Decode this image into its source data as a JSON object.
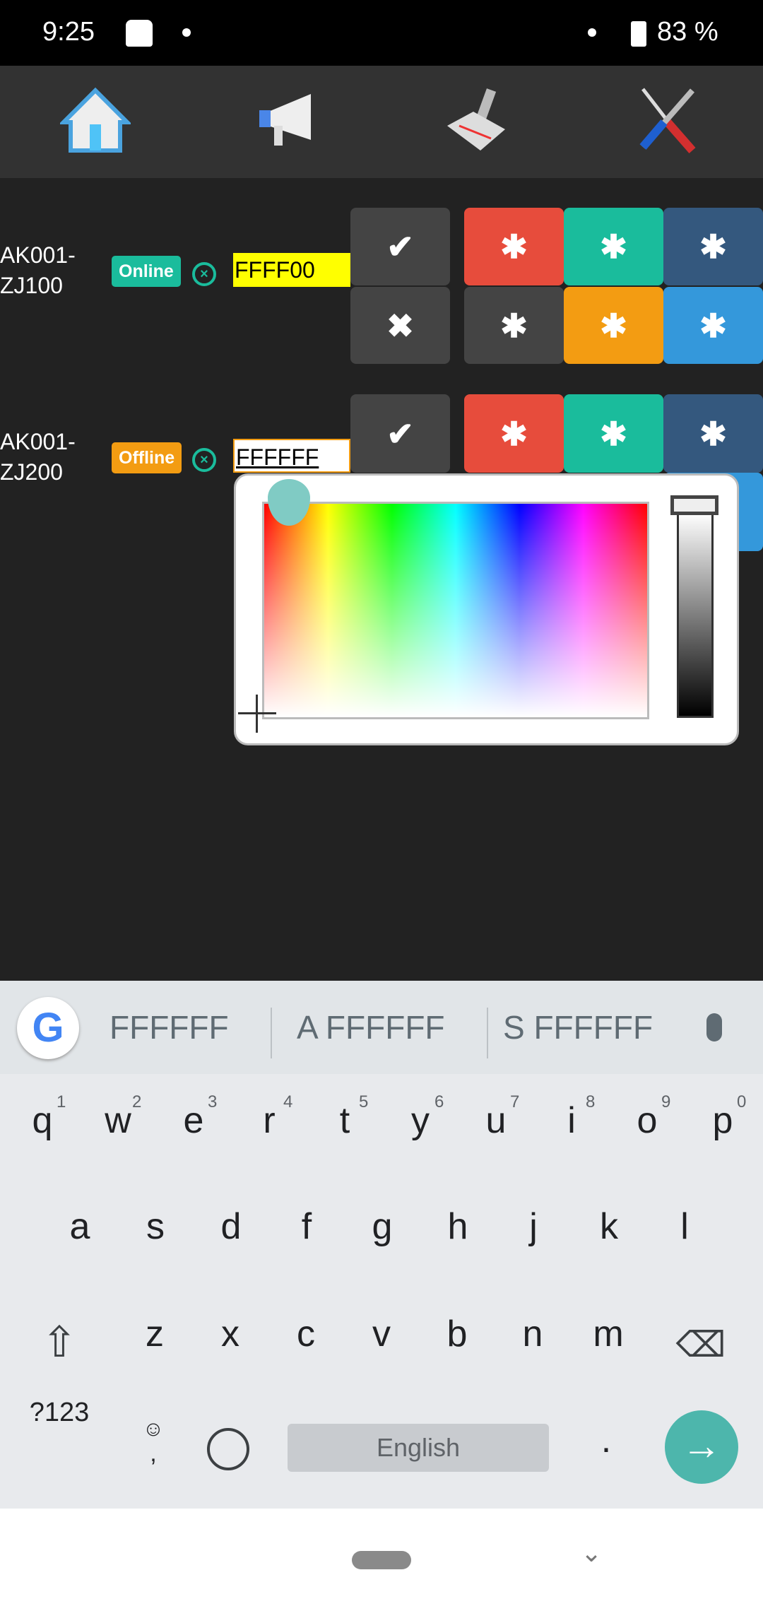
{
  "status_bar": {
    "time": "9:25",
    "battery": "83 %"
  },
  "toolbar": {
    "icons": [
      "home-icon",
      "megaphone-icon",
      "barcode-scanner-icon",
      "tools-icon"
    ]
  },
  "devices": [
    {
      "name_line1": "AK001-",
      "name_line2": "ZJ100",
      "status": "Online",
      "status_color": "#1abc9c",
      "color_value": "FFFF00",
      "input_bg": "#ffff00"
    },
    {
      "name_line1": "AK001-",
      "name_line2": "ZJ200",
      "status": "Offline",
      "status_color": "#f39c12",
      "color_value": "FFFFFF",
      "input_bg": "#ffffff"
    }
  ],
  "button_colors": {
    "dark": "#444444",
    "red": "#e74c3c",
    "green": "#1abc9c",
    "navy": "#34587e",
    "orange": "#f39c12",
    "blue": "#3498db"
  },
  "glyphs": {
    "check": "✔",
    "cross": "✖",
    "asterisk": "✱"
  },
  "keyboard": {
    "suggestions": [
      "FFFFFF",
      "A FFFFFF",
      "S FFFFFF"
    ],
    "row1": [
      "q",
      "w",
      "e",
      "r",
      "t",
      "y",
      "u",
      "i",
      "o",
      "p"
    ],
    "hints": [
      "1",
      "2",
      "3",
      "4",
      "5",
      "6",
      "7",
      "8",
      "9",
      "0"
    ],
    "row2": [
      "a",
      "s",
      "d",
      "f",
      "g",
      "h",
      "j",
      "k",
      "l"
    ],
    "row3": [
      "z",
      "x",
      "c",
      "v",
      "b",
      "n",
      "m"
    ],
    "symbols": "?123",
    "space": "English",
    "period": ".",
    "comma": ","
  }
}
